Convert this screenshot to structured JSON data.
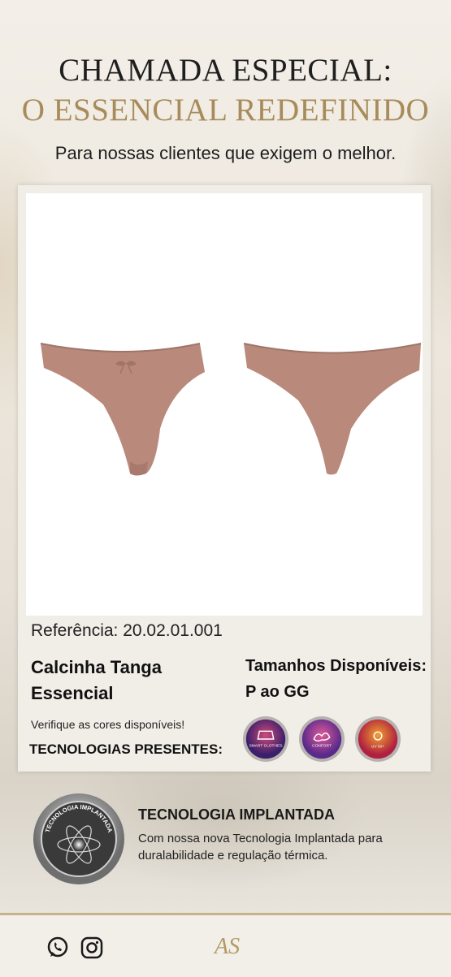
{
  "header": {
    "title_line1": "CHAMADA ESPECIAL:",
    "title_line2": "O ESSENCIAL REDEFINIDO",
    "subtitle": "Para nossas clientes que exigem o melhor."
  },
  "product": {
    "reference": "Referência: 20.02.01.001",
    "name": "Calcinha Tanga Essencial",
    "sizes": "Tamanhos Disponíveis: P ao GG",
    "colors_note": "Verifique as cores disponíveis!",
    "technologies_label": "TECNOLOGIAS PRESENTES:",
    "technologies": [
      {
        "label": "SMART CLOTHES",
        "icon": "smart-clothes-badge",
        "color": "#5b2a7a"
      },
      {
        "label": "CONFORT",
        "icon": "confort-badge",
        "color": "#8a3aa0"
      },
      {
        "label": "UV 50+",
        "icon": "uv-badge",
        "color": "#c0392b"
      }
    ],
    "garment_color": "#b98a7c"
  },
  "implant": {
    "seal_text": "TECNOLOGIA IMPLANTADA",
    "title": "TECNOLOGIA IMPLANTADA",
    "description": "Com nossa nova Tecnologia Implantada para duralabilidade e regulação térmica."
  },
  "footer": {
    "icons": [
      "whatsapp-icon",
      "instagram-icon"
    ],
    "logo": "AS"
  },
  "colors": {
    "gold": "#a88b5a",
    "dark": "#1f1f1f"
  }
}
